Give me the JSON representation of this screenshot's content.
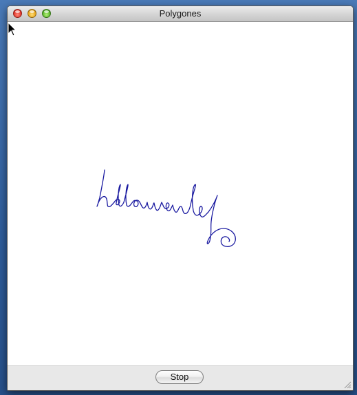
{
  "window": {
    "title": "Polygones",
    "controls": [
      "close-icon",
      "minimize-icon",
      "zoom-icon"
    ]
  },
  "canvas": {
    "content": "handwritten-scribble",
    "stroke_color": "#1a1aa0",
    "background": "#ffffff"
  },
  "toolbar": {
    "stop_label": "Stop"
  },
  "colors": {
    "desktop": "#3b6aa8",
    "bottombar": "#e8e8e8"
  }
}
